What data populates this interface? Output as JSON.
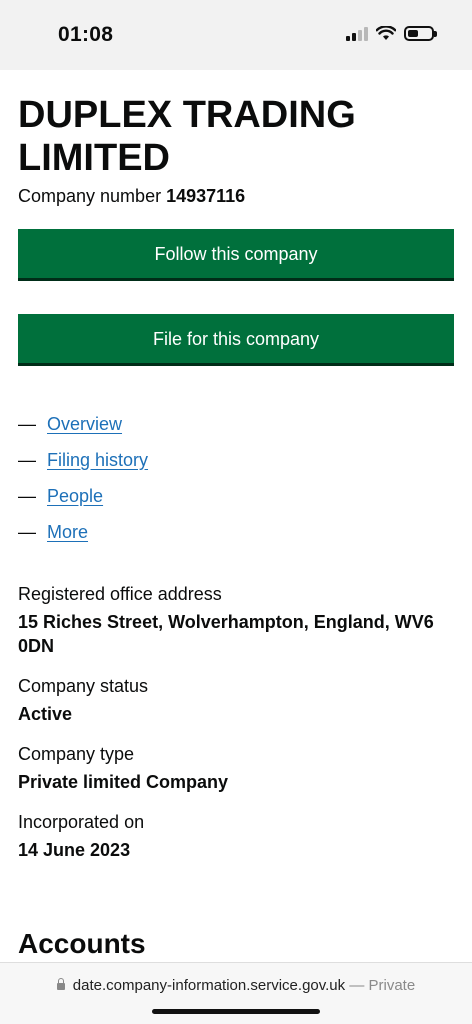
{
  "status_bar": {
    "time": "01:08"
  },
  "company": {
    "name": "DUPLEX TRADING LIMITED",
    "number_label": "Company number",
    "number": "14937116"
  },
  "buttons": {
    "follow": "Follow this company",
    "file": "File for this company"
  },
  "nav": [
    {
      "dash": "—",
      "label": "Overview"
    },
    {
      "dash": "—",
      "label": "Filing history"
    },
    {
      "dash": "—",
      "label": "People"
    },
    {
      "dash": "—",
      "label": "More"
    }
  ],
  "details": {
    "address_label": "Registered office address",
    "address_value": "15 Riches Street, Wolverhampton, England, WV6 0DN",
    "status_label": "Company status",
    "status_value": "Active",
    "type_label": "Company type",
    "type_value": "Private limited Company",
    "incorporated_label": "Incorporated on",
    "incorporated_value": "14 June 2023"
  },
  "accounts_heading": "Accounts",
  "browser": {
    "url": "date.company-information.service.gov.uk",
    "separator": "—",
    "mode": "Private"
  },
  "colors": {
    "button_green": "#00703c",
    "link_blue": "#1d70b8",
    "text": "#0b0c0c"
  }
}
